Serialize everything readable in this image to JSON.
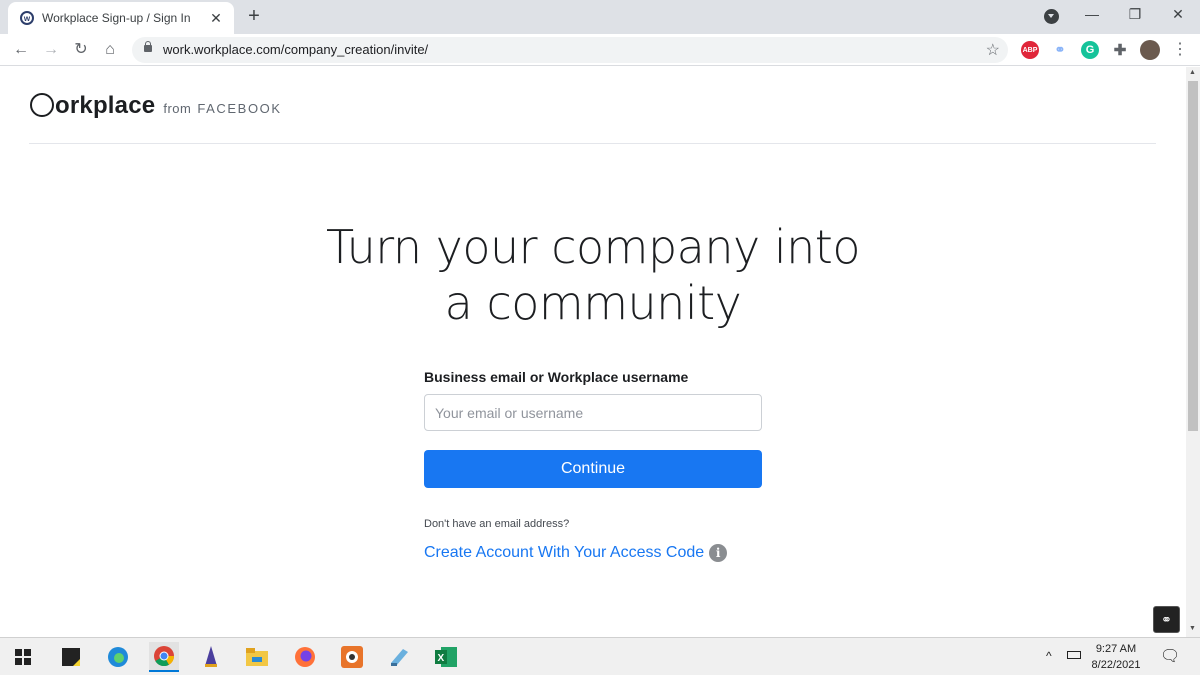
{
  "browser": {
    "tab_title": "Workplace Sign-up / Sign In",
    "tab_close": "✕",
    "new_tab": "+",
    "url": "work.workplace.com/company_creation/invite/",
    "back": "←",
    "forward": "→",
    "reload": "↻",
    "home": "⌂",
    "star": "☆",
    "menu": "⋮",
    "minimize": "—",
    "restore": "❐",
    "close": "✕",
    "extensions": [
      {
        "name": "adblock-plus-icon",
        "text": "ABP",
        "color": "#e0263a"
      },
      {
        "name": "link-extension-icon",
        "text": "",
        "color": "#8ab4f8"
      },
      {
        "name": "grammarly-icon",
        "text": "G",
        "color": "#15c39a"
      },
      {
        "name": "puzzle-icon",
        "text": "",
        "color": "#5f6368"
      }
    ]
  },
  "header": {
    "logo_word": "orkplace",
    "logo_from": "from",
    "logo_brand": "FACEBOOK"
  },
  "main": {
    "headline_line1": "Turn your company into",
    "headline_line2": "a community",
    "field_label": "Business email or Workplace username",
    "email_placeholder": "Your email or username",
    "email_value": "",
    "continue_label": "Continue",
    "no_email_text": "Don't have an email address?",
    "create_account_label": "Create Account With Your Access Code",
    "info_glyph": "i"
  },
  "taskbar": {
    "time": "9:27 AM",
    "date": "8/22/2021",
    "tray_chevron": "^",
    "notification": "🗨"
  },
  "colors": {
    "accent": "#1877f2",
    "text": "#1c1e21",
    "tab_strip": "#dee1e6"
  }
}
